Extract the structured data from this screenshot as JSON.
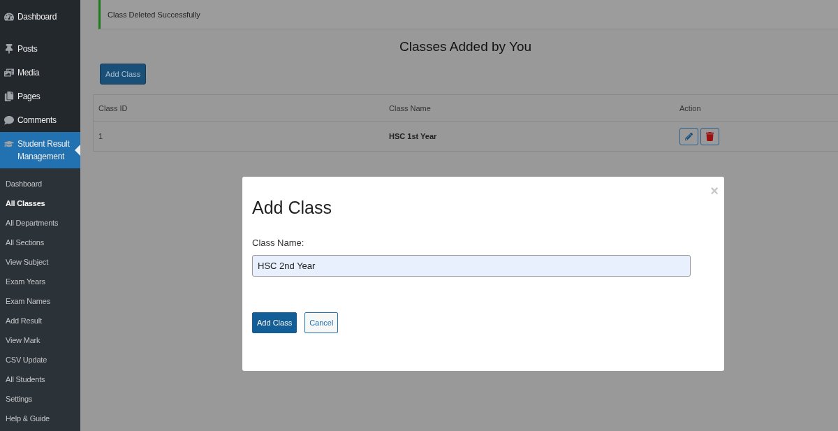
{
  "sidebar": {
    "menu": [
      {
        "label": "Dashboard",
        "selected": false
      },
      {
        "label": "Posts",
        "selected": false
      },
      {
        "label": "Media",
        "selected": false
      },
      {
        "label": "Pages",
        "selected": false
      },
      {
        "label": "Comments",
        "selected": false
      },
      {
        "label": "Student Result Management",
        "selected": true
      }
    ],
    "submenu": [
      {
        "label": "Dashboard",
        "selected": false
      },
      {
        "label": "All Classes",
        "selected": true
      },
      {
        "label": "All Departments",
        "selected": false
      },
      {
        "label": "All Sections",
        "selected": false
      },
      {
        "label": "View Subject",
        "selected": false
      },
      {
        "label": "Exam Years",
        "selected": false
      },
      {
        "label": "Exam Names",
        "selected": false
      },
      {
        "label": "Add Result",
        "selected": false
      },
      {
        "label": "View Mark",
        "selected": false
      },
      {
        "label": "CSV Update",
        "selected": false
      },
      {
        "label": "All Students",
        "selected": false
      },
      {
        "label": "Settings",
        "selected": false
      },
      {
        "label": "Help & Guide",
        "selected": false
      }
    ]
  },
  "notice": {
    "text": "Class Deleted Successfully"
  },
  "heading": "Classes Added by You",
  "add_button": "Add Class",
  "table": {
    "columns": [
      "Class ID",
      "Class Name",
      "Action"
    ],
    "rows": [
      {
        "cells": [
          "1",
          "HSC 1st Year"
        ]
      }
    ]
  },
  "modal": {
    "title": "Add Class",
    "close": "×",
    "label": "Class Name:",
    "value": "HSC 2nd Year",
    "buttons": [
      {
        "label": "Add Class",
        "kind": "primary"
      },
      {
        "label": "Cancel",
        "kind": "secondary"
      }
    ]
  }
}
